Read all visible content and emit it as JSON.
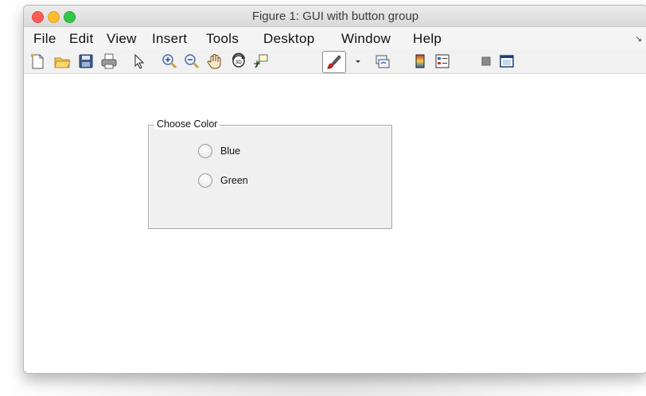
{
  "window": {
    "title": "Figure 1: GUI with button group"
  },
  "menubar": {
    "items": [
      "File",
      "Edit",
      "View",
      "Insert",
      "Tools",
      "Desktop",
      "Window",
      "Help"
    ],
    "overflow_icon": "menu-overflow-arrow-icon"
  },
  "toolbar": {
    "icons": [
      "new-figure-icon",
      "open-file-icon",
      "save-icon",
      "print-icon",
      "pointer-icon",
      "zoom-in-icon",
      "zoom-out-icon",
      "pan-hand-icon",
      "rotate-3d-icon",
      "data-cursor-icon",
      "brush-icon",
      "brush-dropdown-icon",
      "link-plot-icon",
      "insert-colorbar-icon",
      "insert-legend-icon",
      "hide-plot-tools-icon",
      "show-plot-tools-icon"
    ]
  },
  "panel": {
    "title": "Choose Color",
    "options": [
      {
        "label": "Blue",
        "selected": false
      },
      {
        "label": "Green",
        "selected": false
      }
    ]
  }
}
